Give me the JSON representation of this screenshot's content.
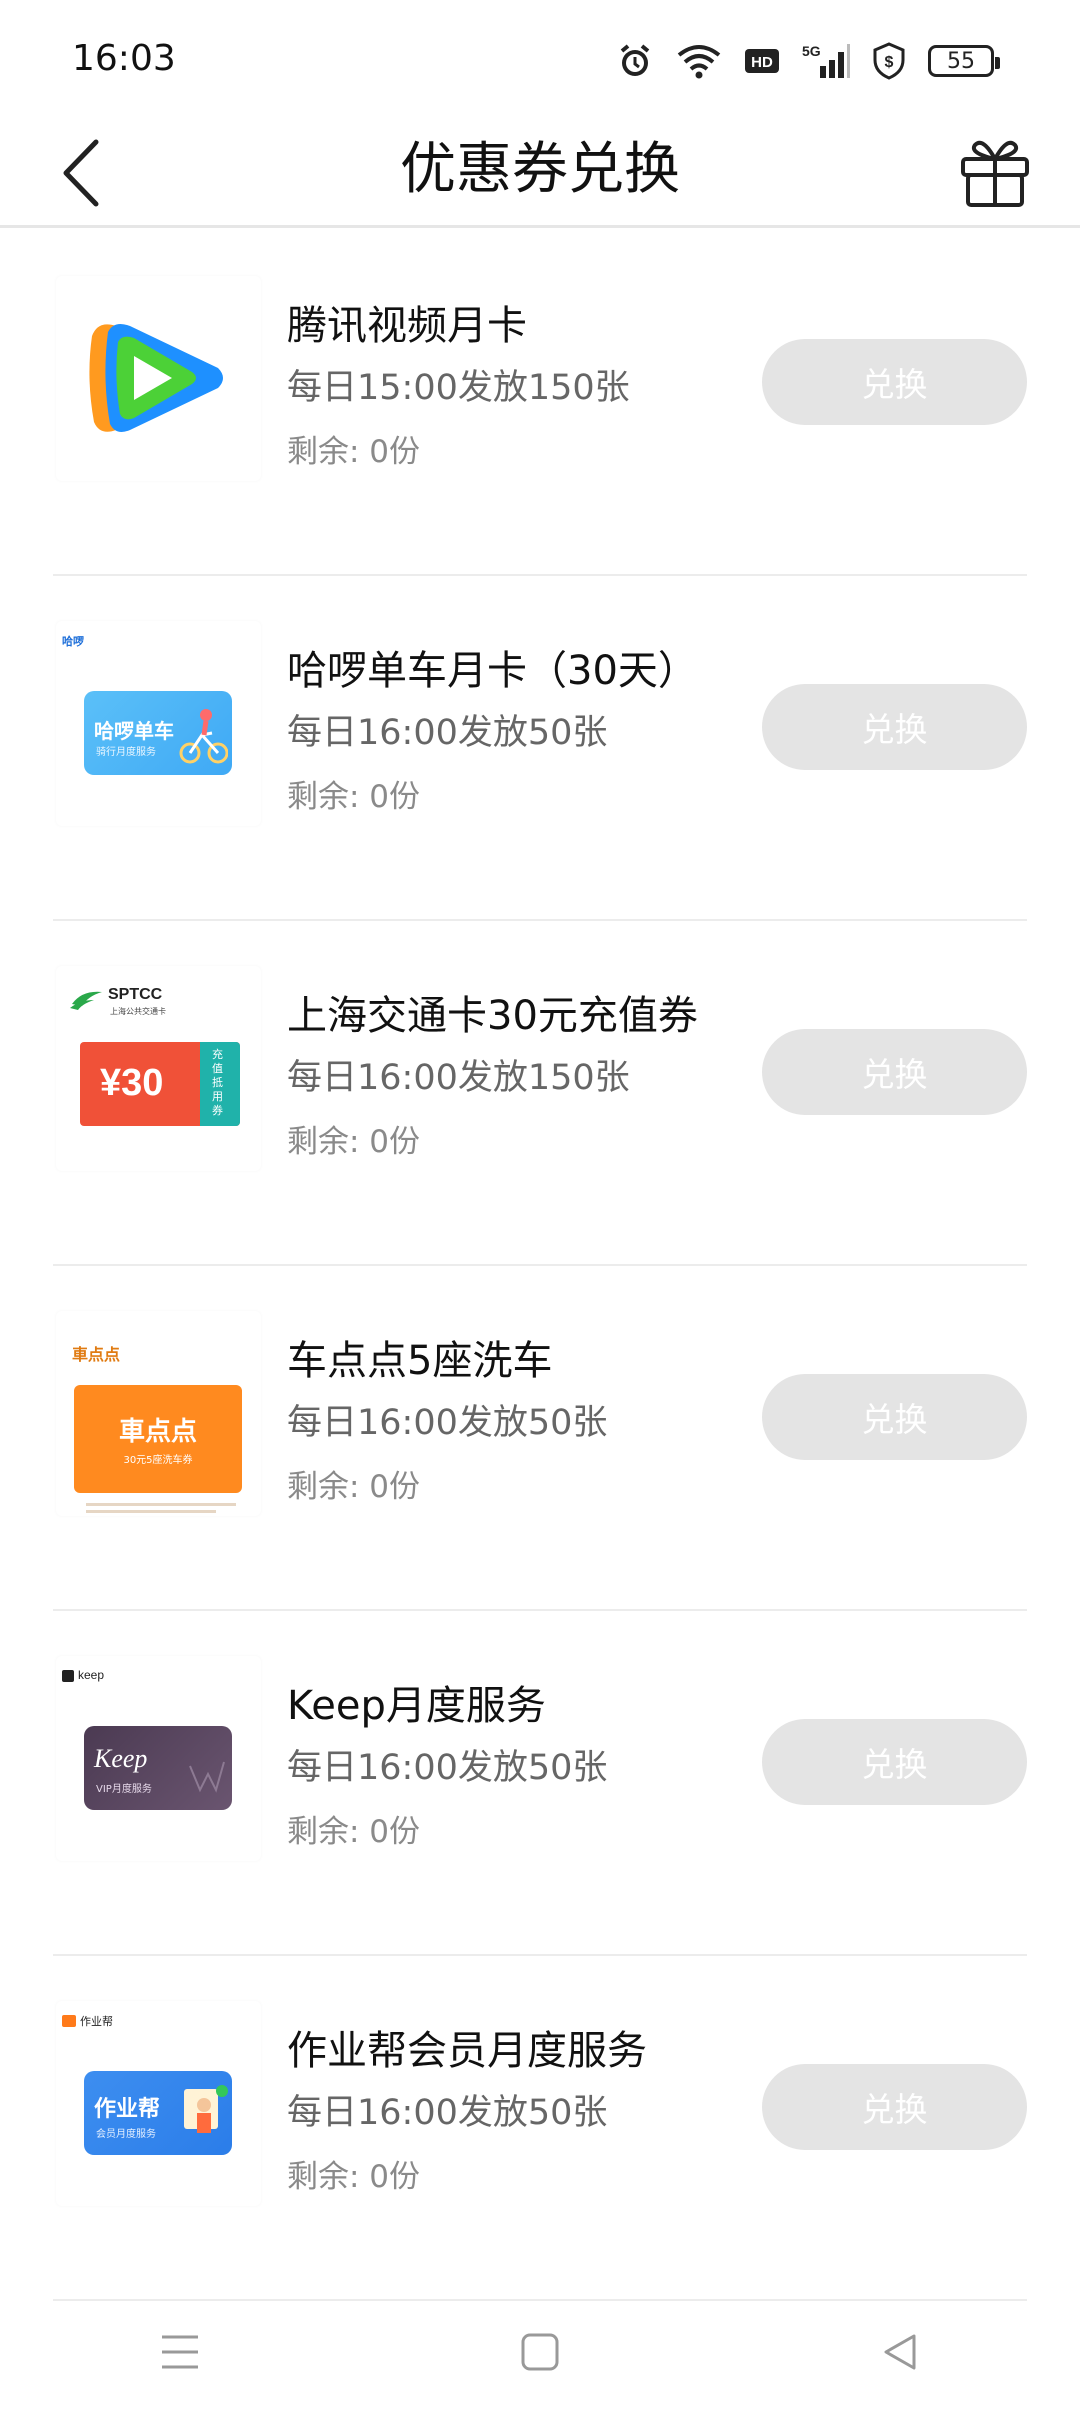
{
  "status_bar": {
    "time": "16:03",
    "network": "5G",
    "hd_label": "HD",
    "battery": "55"
  },
  "header": {
    "title": "优惠券兑换"
  },
  "coupons": [
    {
      "title": "腾讯视频月卡",
      "schedule": "每日15:00发放150张",
      "remaining": "剩余: 0份",
      "button": "兑换",
      "thumb": {
        "type": "tencent-video-logo"
      }
    },
    {
      "title": "哈啰单车月卡（30天）",
      "schedule": "每日16:00发放50张",
      "remaining": "剩余: 0份",
      "button": "兑换",
      "thumb": {
        "type": "hello-bike-card",
        "brand": "哈啰单车",
        "sub": "骑行月度服务",
        "corner": "哈啰"
      }
    },
    {
      "title": "上海交通卡30元充值券",
      "schedule": "每日16:00发放150张",
      "remaining": "剩余: 0份",
      "button": "兑换",
      "thumb": {
        "type": "sptcc-coupon",
        "brand": "SPTCC",
        "brand_sub": "上海公共交通卡",
        "amount": "¥30",
        "side": "充值抵用券"
      }
    },
    {
      "title": "车点点5座洗车",
      "schedule": "每日16:00发放50张",
      "remaining": "剩余: 0份",
      "button": "兑换",
      "thumb": {
        "type": "chediandian-card",
        "brand": "車点点",
        "sub": "30元5座洗车券"
      }
    },
    {
      "title": "Keep月度服务",
      "schedule": "每日16:00发放50张",
      "remaining": "剩余: 0份",
      "button": "兑换",
      "thumb": {
        "type": "keep-card",
        "brand": "Keep",
        "sub": "VIP月度服务",
        "corner": "keep"
      }
    },
    {
      "title": "作业帮会员月度服务",
      "schedule": "每日16:00发放50张",
      "remaining": "剩余: 0份",
      "button": "兑换",
      "thumb": {
        "type": "zuoyebang-card",
        "brand": "作业帮",
        "sub": "会员月度服务",
        "corner": "作业帮"
      }
    }
  ],
  "colors": {
    "button_disabled_bg": "#e4e4e4",
    "button_disabled_text": "#ffffff",
    "divider": "#ececec",
    "tencent_blue": "#1e90ff",
    "tencent_orange": "#ff9a1f",
    "tencent_green": "#4cd137",
    "hello_blue": "#3fa9f5",
    "sptcc_red": "#f05138",
    "sptcc_teal": "#20b2aa",
    "chediandian_orange": "#ff8a1f",
    "keep_purple": "#5a4660",
    "zuoyebang_blue": "#2b7de9"
  },
  "nav_bar": {
    "icons": [
      "menu-icon",
      "home-square-icon",
      "back-triangle-icon"
    ]
  }
}
